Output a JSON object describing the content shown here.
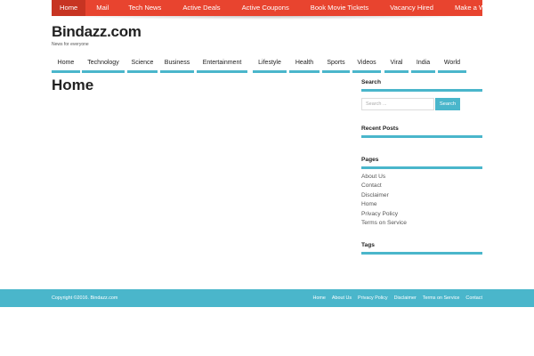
{
  "topnav": {
    "items": [
      {
        "label": "Home"
      },
      {
        "label": "Mail"
      },
      {
        "label": "Tech News"
      },
      {
        "label": "Active Deals"
      },
      {
        "label": "Active Coupons"
      },
      {
        "label": "Book Movie Tickets"
      },
      {
        "label": "Vacancy Hired"
      },
      {
        "label": "Make a Website"
      }
    ],
    "active_index": 0
  },
  "brand": {
    "title": "Bindazz.com",
    "tagline": "News for everyone"
  },
  "mainnav": {
    "items": [
      {
        "label": "Home"
      },
      {
        "label": "Technology"
      },
      {
        "label": "Science"
      },
      {
        "label": "Business"
      },
      {
        "label": "Entertainment"
      },
      {
        "label": "Lifestyle"
      },
      {
        "label": "Health"
      },
      {
        "label": "Sports"
      },
      {
        "label": "Videos"
      },
      {
        "label": "Viral"
      },
      {
        "label": "India"
      },
      {
        "label": "World"
      }
    ]
  },
  "main": {
    "title": "Home"
  },
  "sidebar": {
    "search": {
      "title": "Search",
      "placeholder": "Search ...",
      "button_label": "Search"
    },
    "recent_posts": {
      "title": "Recent Posts"
    },
    "pages": {
      "title": "Pages",
      "items": [
        {
          "label": "About Us"
        },
        {
          "label": "Contact"
        },
        {
          "label": "Disclaimer"
        },
        {
          "label": "Home"
        },
        {
          "label": "Privacy Policy"
        },
        {
          "label": "Terms on Service"
        }
      ]
    },
    "tags": {
      "title": "Tags"
    }
  },
  "footer": {
    "copyright": "Copyright ©2016. Bindazz.com",
    "links": [
      {
        "label": "Home"
      },
      {
        "label": "About Us"
      },
      {
        "label": "Privacy Policy"
      },
      {
        "label": "Disclaimer"
      },
      {
        "label": "Terms on Service"
      },
      {
        "label": "Contact"
      }
    ]
  },
  "colors": {
    "topnav_bg": "#e8442f",
    "topnav_active": "#c73422",
    "accent": "#4ab6cb"
  }
}
